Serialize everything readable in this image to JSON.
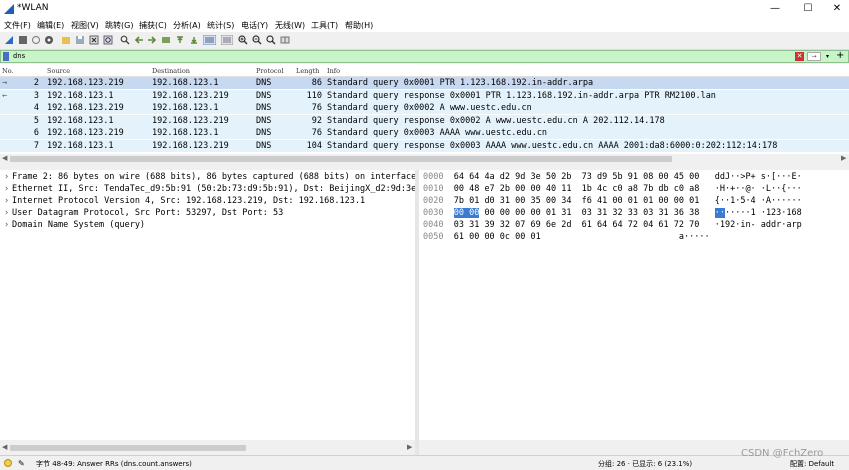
{
  "window": {
    "title": "*WLAN",
    "minimize": "—",
    "maximize": "☐",
    "close": "✕"
  },
  "menu": [
    "文件(F)",
    "编辑(E)",
    "视图(V)",
    "跳转(G)",
    "捕获(C)",
    "分析(A)",
    "统计(S)",
    "电话(Y)",
    "无线(W)",
    "工具(T)",
    "帮助(H)"
  ],
  "filter": {
    "value": "dns",
    "apply_symbol": "→",
    "dropdown_symbol": "▾",
    "add_symbol": "+",
    "clear_symbol": "✕"
  },
  "packet_list": {
    "columns": [
      "No.",
      "Source",
      "Destination",
      "Protocol",
      "Length",
      "Info"
    ],
    "rows": [
      {
        "no": "2",
        "source": "192.168.123.219",
        "destination": "192.168.123.1",
        "protocol": "DNS",
        "length": "86",
        "info": "Standard query 0x0001 PTR 1.123.168.192.in-addr.arpa",
        "selected": true,
        "marker": "→"
      },
      {
        "no": "3",
        "source": "192.168.123.1",
        "destination": "192.168.123.219",
        "protocol": "DNS",
        "length": "110",
        "info": "Standard query response 0x0001 PTR 1.123.168.192.in-addr.arpa PTR RM2100.lan",
        "selected": false,
        "marker": "←"
      },
      {
        "no": "4",
        "source": "192.168.123.219",
        "destination": "192.168.123.1",
        "protocol": "DNS",
        "length": "76",
        "info": "Standard query 0x0002 A www.uestc.edu.cn",
        "selected": false,
        "marker": ""
      },
      {
        "no": "5",
        "source": "192.168.123.1",
        "destination": "192.168.123.219",
        "protocol": "DNS",
        "length": "92",
        "info": "Standard query response 0x0002 A www.uestc.edu.cn A 202.112.14.178",
        "selected": false,
        "marker": ""
      },
      {
        "no": "6",
        "source": "192.168.123.219",
        "destination": "192.168.123.1",
        "protocol": "DNS",
        "length": "76",
        "info": "Standard query 0x0003 AAAA www.uestc.edu.cn",
        "selected": false,
        "marker": ""
      },
      {
        "no": "7",
        "source": "192.168.123.1",
        "destination": "192.168.123.219",
        "protocol": "DNS",
        "length": "104",
        "info": "Standard query response 0x0003 AAAA www.uestc.edu.cn AAAA 2001:da8:6000:0:202:112:14:178",
        "selected": false,
        "marker": ""
      }
    ]
  },
  "details": [
    "Frame 2: 86 bytes on wire (688 bits), 86 bytes captured (688 bits) on interface \\",
    "Ethernet II, Src: TendaTec_d9:5b:91 (50:2b:73:d9:5b:91), Dst: BeijingX_d2:9d:3e (",
    "Internet Protocol Version 4, Src: 192.168.123.219, Dst: 192.168.123.1",
    "User Datagram Protocol, Src Port: 53297, Dst Port: 53",
    "Domain Name System (query)"
  ],
  "hex": [
    {
      "offset": "0000",
      "bytes": "64 64 4a d2 9d 3e 50 2b  73 d9 5b 91 08 00 45 00",
      "ascii": "ddJ··>P+ s·[···E·"
    },
    {
      "offset": "0010",
      "bytes": "00 48 e7 2b 00 00 40 11  1b 4c c0 a8 7b db c0 a8",
      "ascii": "·H·+··@· ·L··{···"
    },
    {
      "offset": "0020",
      "bytes": "7b 01 d0 31 00 35 00 34  f6 41 00 01 01 00 00 01",
      "ascii": "{··1·5·4 ·A······"
    },
    {
      "offset": "0030",
      "bytes_hl": "00 00",
      "bytes": " 00 00 00 00 01 31  03 31 32 33 03 31 36 38",
      "ascii_hl": "··",
      "ascii": "·····1 ·123·168"
    },
    {
      "offset": "0040",
      "bytes": "03 31 39 32 07 69 6e 2d  61 64 64 72 04 61 72 70",
      "ascii": "·192·in- addr·arp"
    },
    {
      "offset": "0050",
      "bytes": "61 00 00 0c 00 01",
      "ascii": "a·····"
    }
  ],
  "status": {
    "field": "字节 48-49: Answer RRs (dns.count.answers)",
    "packets": "分组: 26 · 已显示: 6 (23.1%)",
    "profile": "配置: Default"
  },
  "watermark": "CSDN @FchZero",
  "colors": {
    "row": "#e4f3fb",
    "row_selected": "#c7d9f0",
    "filter_bg": "#c8f5c8",
    "hex_highlight": "#3b7bd1"
  }
}
